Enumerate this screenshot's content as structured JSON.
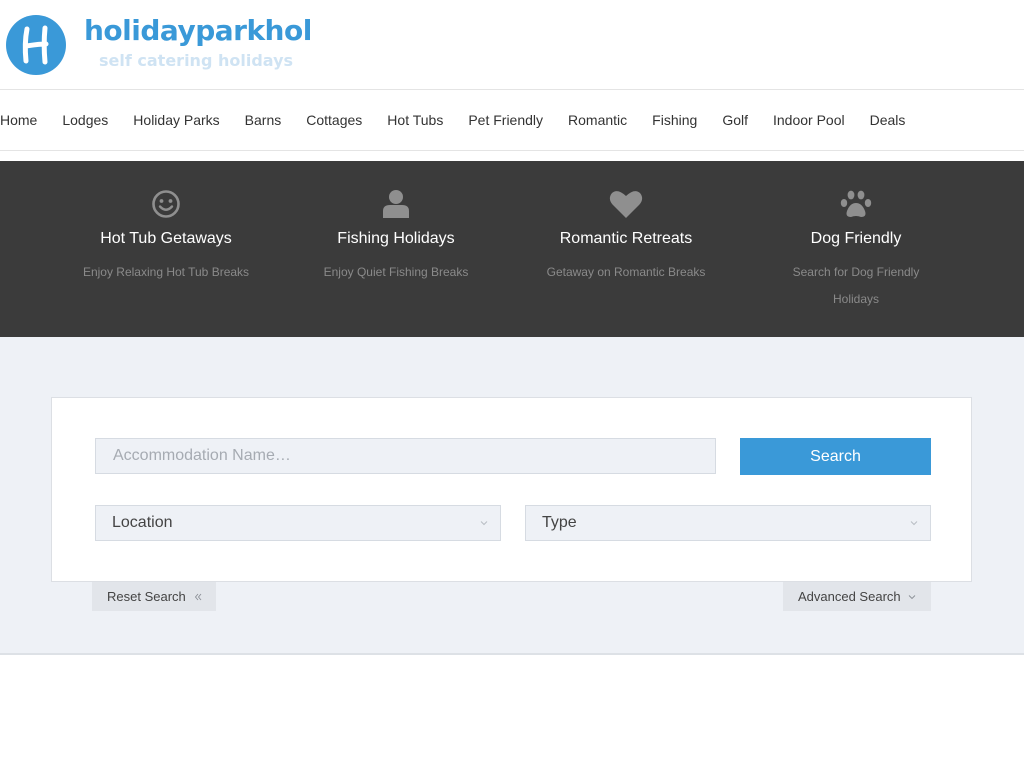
{
  "brand": {
    "name": "holidayparkhol",
    "tagline": "self catering holidays",
    "badge_letter": "H",
    "color": "#3a99d8"
  },
  "nav": {
    "items": [
      "Home",
      "Lodges",
      "Holiday Parks",
      "Barns",
      "Cottages",
      "Hot Tubs",
      "Pet Friendly",
      "Romantic",
      "Fishing",
      "Golf",
      "Indoor Pool",
      "Deals"
    ]
  },
  "features": [
    {
      "icon": "smiley-icon",
      "title": "Hot Tub Getaways",
      "subtitle": "Enjoy Relaxing Hot Tub Breaks"
    },
    {
      "icon": "user-icon",
      "title": "Fishing Holidays",
      "subtitle": "Enjoy Quiet Fishing Breaks"
    },
    {
      "icon": "heart-icon",
      "title": "Romantic Retreats",
      "subtitle": "Getaway on Romantic Breaks"
    },
    {
      "icon": "paw-icon",
      "title": "Dog Friendly",
      "subtitle": "Search for Dog Friendly Holidays"
    }
  ],
  "search": {
    "name_placeholder": "Accommodation Name…",
    "name_value": "",
    "button_label": "Search",
    "location_label": "Location",
    "type_label": "Type",
    "reset_label": "Reset Search",
    "advanced_label": "Advanced Search"
  },
  "colors": {
    "accent": "#3a99d8",
    "band": "#3b3b3b",
    "search_bg": "#eef1f6"
  }
}
